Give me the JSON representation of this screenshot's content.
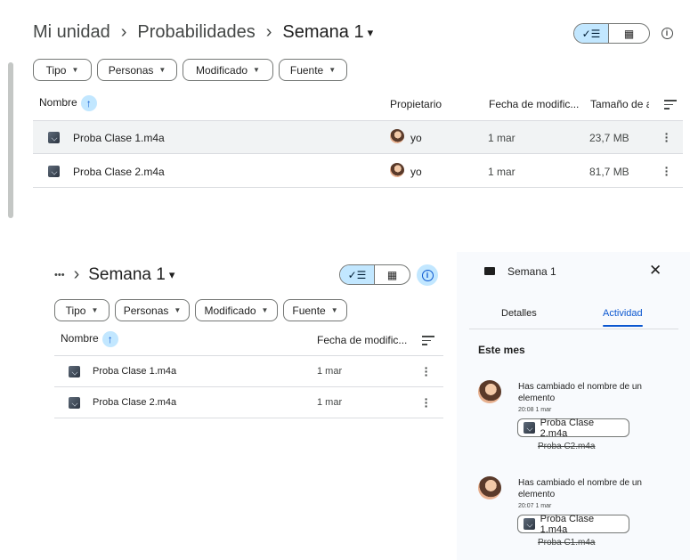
{
  "top": {
    "breadcrumb": [
      "Mi unidad",
      "Probabilidades",
      "Semana 1"
    ],
    "breadcrumb_sep": "›",
    "filters": [
      "Tipo",
      "Personas",
      "Modificado",
      "Fuente"
    ],
    "columns": {
      "name": "Nombre",
      "owner": "Propietario",
      "modified": "Fecha de modific...",
      "size": "Tamaño de a"
    },
    "rows": [
      {
        "name": "Proba Clase 1.m4a",
        "owner": "yo",
        "modified": "1 mar",
        "size": "23,7 MB"
      },
      {
        "name": "Proba Clase 2.m4a",
        "owner": "yo",
        "modified": "1 mar",
        "size": "81,7 MB"
      }
    ]
  },
  "bottom": {
    "breadcrumb_more": "•••",
    "breadcrumb_sep": "›",
    "folder": "Semana 1",
    "filters": [
      "Tipo",
      "Personas",
      "Modificado",
      "Fuente"
    ],
    "columns": {
      "name": "Nombre",
      "modified": "Fecha de modific..."
    },
    "rows": [
      {
        "name": "Proba Clase 1.m4a",
        "modified": "1 mar"
      },
      {
        "name": "Proba Clase 2.m4a",
        "modified": "1 mar"
      }
    ]
  },
  "panel": {
    "title": "Semana 1",
    "tabs": [
      "Detalles",
      "Actividad"
    ],
    "active_tab": "Actividad",
    "section": "Este mes",
    "events": [
      {
        "text_1": "Has cambiado el nombre de un",
        "text_2": "elemento",
        "time": "20:08 1 mar",
        "new_name": "Proba Clase 2.m4a",
        "old_name": "Proba C2.m4a"
      },
      {
        "text_1": "Has cambiado el nombre de un",
        "text_2": "elemento",
        "time": "20:07 1 mar",
        "new_name": "Proba Clase 1.m4a",
        "old_name": "Proba C1.m4a"
      }
    ]
  },
  "icons": {
    "list_view": "check-list-icon",
    "grid_view": "grid-icon",
    "info": "info-icon",
    "sort": "sort-icon",
    "sort_arrow": "arrow-up-icon",
    "more": "more-vert-icon",
    "folder": "folder-icon",
    "close": "close-icon",
    "audio": "audio-file-icon"
  },
  "colors": {
    "accent": "#0b57d0",
    "selected_row": "#f1f3f4",
    "toggle_on": "#c2e7ff",
    "panel_bg": "#f8fafd"
  }
}
